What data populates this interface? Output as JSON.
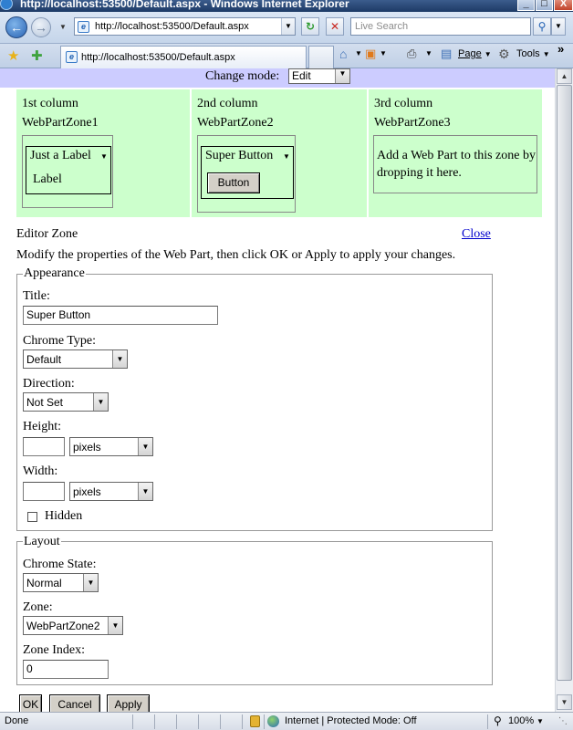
{
  "window": {
    "title": "http://localhost:53500/Default.aspx - Windows Internet Explorer",
    "minimize": "_",
    "restore": "□",
    "close": "X"
  },
  "address_bar": {
    "url": "http://localhost:53500/Default.aspx",
    "search_placeholder": "Live Search"
  },
  "tab": {
    "label": "http://localhost:53500/Default.aspx"
  },
  "command_bar": {
    "page": "Page",
    "tools": "Tools",
    "more": "»"
  },
  "page": {
    "mode_label": "Change mode:",
    "mode_value": "Edit",
    "zones": [
      {
        "column": "1st column",
        "name": "WebPartZone1",
        "part_title": "Just a Label",
        "part_content": "Label"
      },
      {
        "column": "2nd column",
        "name": "WebPartZone2",
        "part_title": "Super Button",
        "part_content": "Button"
      },
      {
        "column": "3rd column",
        "name": "WebPartZone3",
        "empty_text": "Add a Web Part to this zone by dropping it here."
      }
    ],
    "editor": {
      "title": "Editor Zone",
      "close": "Close",
      "description": "Modify the properties of the Web Part, then click OK or Apply to apply your changes.",
      "appearance": {
        "legend": "Appearance",
        "title_label": "Title:",
        "title_value": "Super Button",
        "chrome_type_label": "Chrome Type:",
        "chrome_type_value": "Default",
        "direction_label": "Direction:",
        "direction_value": "Not Set",
        "height_label": "Height:",
        "height_value": "",
        "height_unit": "pixels",
        "width_label": "Width:",
        "width_value": "",
        "width_unit": "pixels",
        "hidden_label": "Hidden"
      },
      "layout": {
        "legend": "Layout",
        "chrome_state_label": "Chrome State:",
        "chrome_state_value": "Normal",
        "zone_label": "Zone:",
        "zone_value": "WebPartZone2",
        "zone_index_label": "Zone Index:",
        "zone_index_value": "0"
      },
      "buttons": {
        "ok": "OK",
        "cancel": "Cancel",
        "apply": "Apply"
      }
    }
  },
  "status_bar": {
    "status": "Done",
    "zone_text": "Internet | Protected Mode: Off",
    "zoom": "100%"
  }
}
